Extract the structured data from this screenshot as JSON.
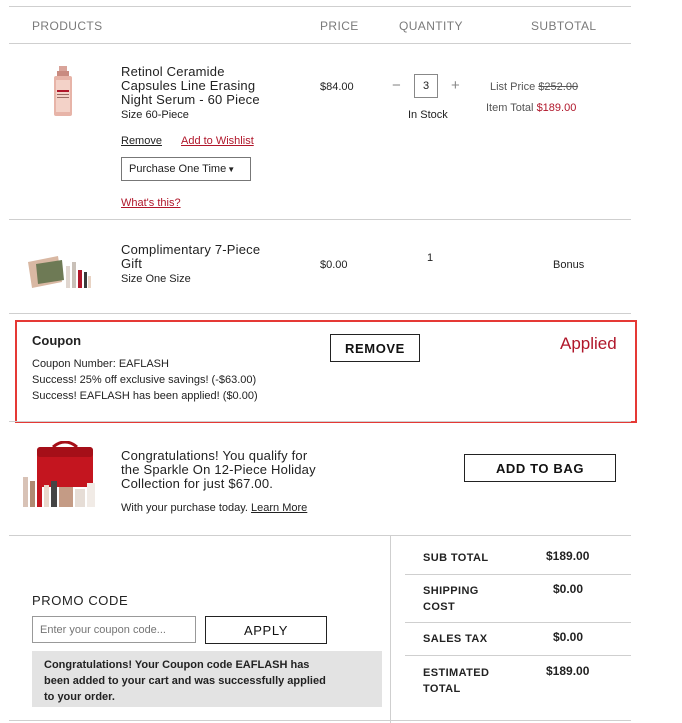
{
  "header": {
    "products": "PRODUCTS",
    "price": "PRICE",
    "quantity": "QUANTITY",
    "subtotal": "SUBTOTAL"
  },
  "items": [
    {
      "name_line1": "Retinol Ceramide",
      "name_line2": "Capsules Line Erasing",
      "name_line3": "Night Serum - 60 Piece",
      "size": "Size 60-Piece",
      "price": "$84.00",
      "quantity": "3",
      "minus": "−",
      "plus": "+",
      "stock": "In Stock",
      "list_price_label": "List Price",
      "list_price": "$252.00",
      "item_total_label": "Item Total",
      "item_total": "$189.00",
      "remove": "Remove",
      "wishlist": "Add to Wishlist",
      "purchase_option": "Purchase One Time",
      "whats_this": "What's this?"
    },
    {
      "name_line1": "Complimentary 7-Piece",
      "name_line2": "Gift",
      "size": "Size One Size",
      "price": "$0.00",
      "quantity": "1",
      "subtotal": "Bonus"
    }
  ],
  "coupon": {
    "title": "Coupon",
    "number": "Coupon Number: EAFLASH",
    "line1": "Success! 25% off exclusive savings! (-$63.00)",
    "line2": "Success! EAFLASH has been applied! ($0.00)",
    "remove": "REMOVE",
    "status": "Applied",
    "highlight_color": "#e53935"
  },
  "offer": {
    "line1": "Congratulations! You qualify for",
    "line2": "the Sparkle On 12-Piece Holiday",
    "line3": "Collection for just $67.00.",
    "purchase_note": "With your purchase today.",
    "learn_more": "Learn More",
    "button": "ADD TO BAG"
  },
  "promo": {
    "title": "PROMO CODE",
    "placeholder": "Enter your coupon code...",
    "apply": "APPLY",
    "message_line1": "Congratulations! Your Coupon code EAFLASH has",
    "message_line2": "been added to your cart and was successfully applied",
    "message_line3": "to your order."
  },
  "summary": {
    "sub_total_label": "SUB TOTAL",
    "sub_total": "$189.00",
    "shipping_label_1": "SHIPPING",
    "shipping_label_2": "COST",
    "shipping": "$0.00",
    "tax_label": "SALES TAX",
    "tax": "$0.00",
    "estimated_label_1": "ESTIMATED",
    "estimated_label_2": "TOTAL",
    "estimated": "$189.00"
  },
  "colors": {
    "accent_red": "#b0162a",
    "border_gray": "#cfcfcf",
    "message_bg": "#e3e3e3"
  }
}
